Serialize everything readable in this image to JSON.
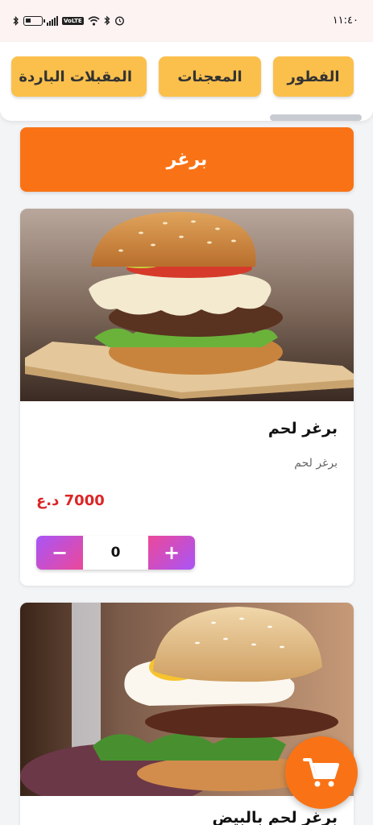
{
  "status_bar": {
    "time": "١١:٤٠",
    "volte": "VoLTE"
  },
  "categories": [
    {
      "label": "الفطور"
    },
    {
      "label": "المعجنات"
    },
    {
      "label": "المقبلات الباردة"
    }
  ],
  "section": {
    "title": "برغر"
  },
  "items": [
    {
      "name": "برغر لحم",
      "description": "برغر لحم",
      "price": "7000 د.ع",
      "quantity": "0"
    },
    {
      "name": "برغر لحم بالبيض"
    }
  ],
  "stepper": {
    "minus": "−",
    "plus": "+"
  },
  "icons": {
    "status": [
      "bluetooth-icon",
      "battery-icon",
      "signal-icon",
      "volte-icon",
      "wifi-icon",
      "alarm-icon"
    ],
    "cart": "shopping-cart-icon"
  },
  "colors": {
    "accent": "#f97316",
    "category": "#fbc04c",
    "price": "#dc2626",
    "stepper_start": "#a855f7",
    "stepper_end": "#ec4899"
  }
}
